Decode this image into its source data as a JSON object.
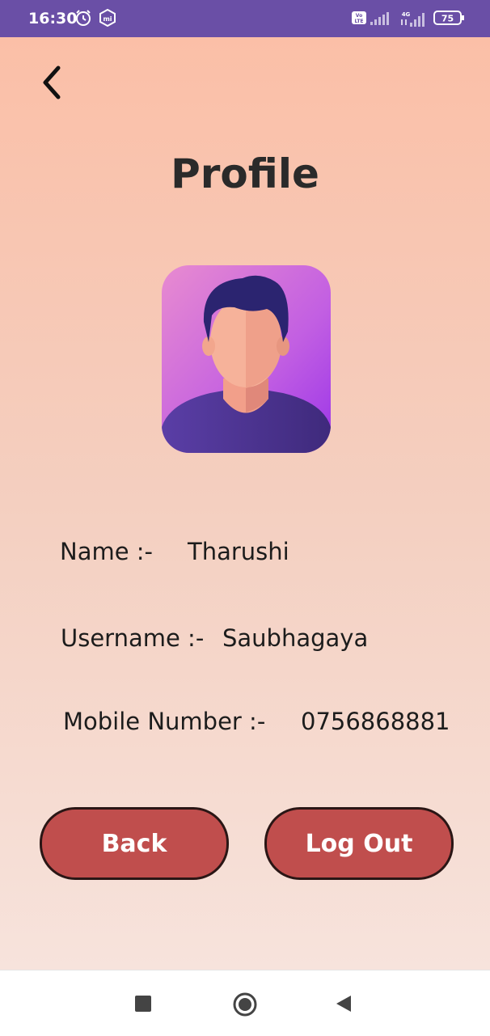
{
  "status_bar": {
    "time": "16:30",
    "battery": "75",
    "network": "4G",
    "volte": "VoLTE",
    "icons": [
      "alarm-icon",
      "mi-icon",
      "volte-icon",
      "signal-icon",
      "battery-icon"
    ]
  },
  "screen": {
    "title": "Profile"
  },
  "profile": {
    "name_label": "Name :-",
    "name_value": "Tharushi",
    "username_label": "Username :-",
    "username_value": "Saubhagaya",
    "mobile_label": "Mobile Number :-",
    "mobile_value": "0756868881"
  },
  "buttons": {
    "back_label": "Back",
    "logout_label": "Log Out"
  },
  "colors": {
    "status_bar": "#6a4fa6",
    "button": "#c04e4d",
    "gradient_top": "#fbbfa7",
    "gradient_bottom": "#f7e3dc"
  },
  "nav_bar": {
    "icons": [
      "recents-icon",
      "home-icon",
      "back-nav-icon"
    ]
  }
}
